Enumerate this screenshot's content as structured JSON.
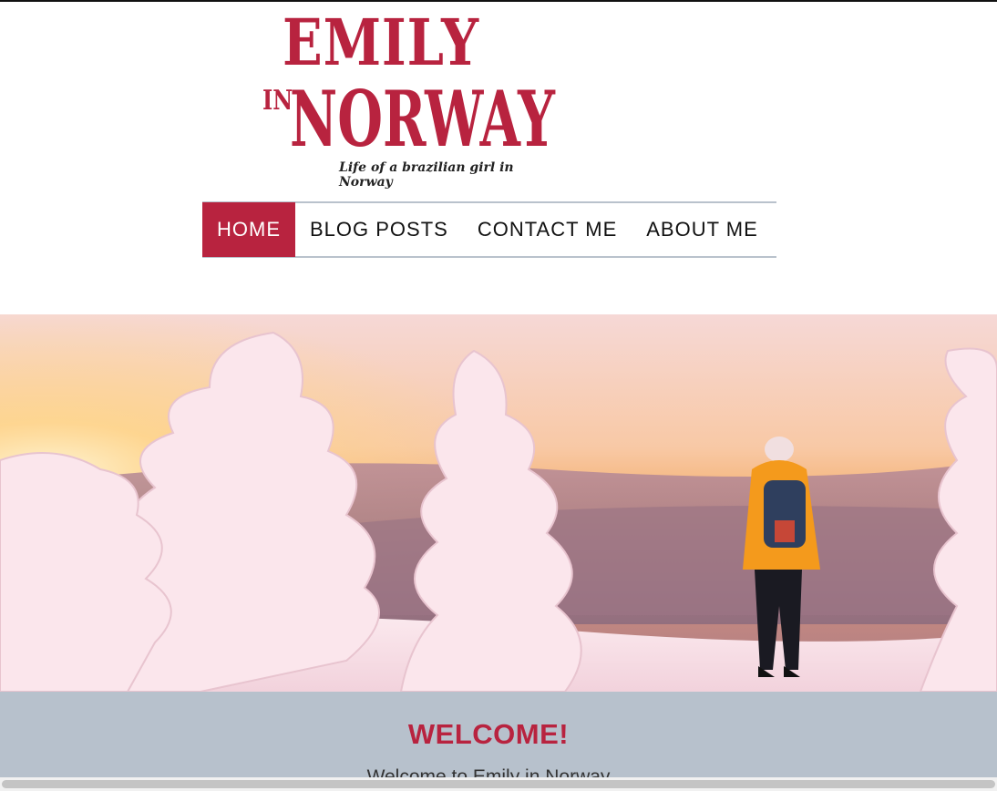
{
  "logo": {
    "line1": "EMILY",
    "line2_small": "IN",
    "line2": "NORWAY",
    "tagline": "Life of a brazilian girl in Norway"
  },
  "nav": {
    "items": [
      {
        "label": "HOME",
        "active": true
      },
      {
        "label": "BLOG POSTS",
        "active": false
      },
      {
        "label": "CONTACT ME",
        "active": false
      },
      {
        "label": "ABOUT ME",
        "active": false
      }
    ]
  },
  "welcome": {
    "title": "WELCOME!",
    "text": "Welcome to Emily in Norway"
  },
  "colors": {
    "brand": "#b8233f",
    "band": "#b7c1cc",
    "nav_border": "#b9c2cc"
  }
}
